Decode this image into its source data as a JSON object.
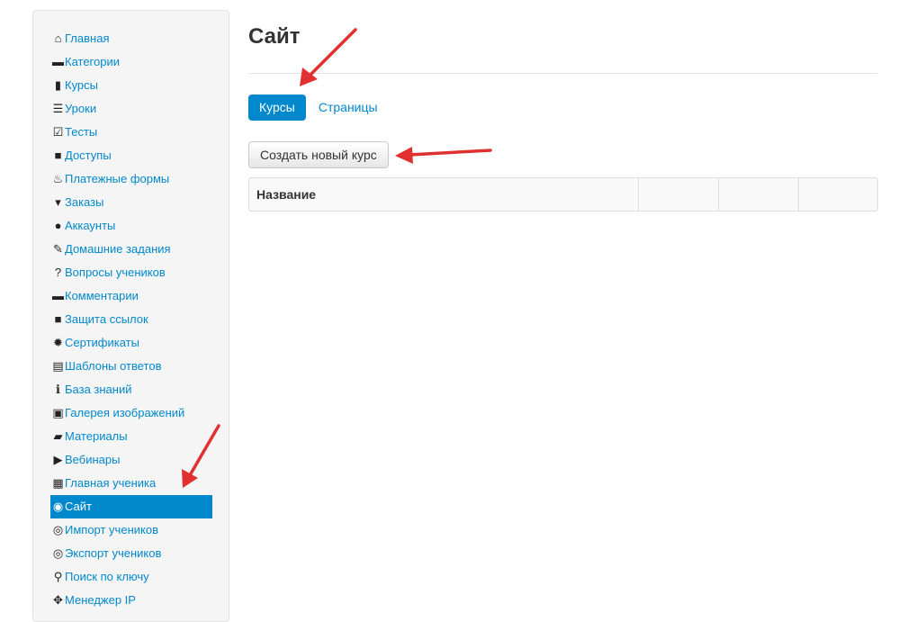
{
  "sidebar": {
    "items": [
      {
        "label": "Главная",
        "icon": "home-icon",
        "glyph": "⌂"
      },
      {
        "label": "Категории",
        "icon": "folder-icon",
        "glyph": "▬"
      },
      {
        "label": "Курсы",
        "icon": "book-icon",
        "glyph": "▮"
      },
      {
        "label": "Уроки",
        "icon": "list-icon",
        "glyph": "☰"
      },
      {
        "label": "Тесты",
        "icon": "edit-icon",
        "glyph": "☑"
      },
      {
        "label": "Доступы",
        "icon": "lock-icon",
        "glyph": "■"
      },
      {
        "label": "Платежные формы",
        "icon": "fire-icon",
        "glyph": "♨"
      },
      {
        "label": "Заказы",
        "icon": "cart-icon",
        "glyph": "▾"
      },
      {
        "label": "Аккаунты",
        "icon": "user-icon",
        "glyph": "●"
      },
      {
        "label": "Домашние задания",
        "icon": "pencil-icon",
        "glyph": "✎"
      },
      {
        "label": "Вопросы учеников",
        "icon": "question-icon",
        "glyph": "?"
      },
      {
        "label": "Комментарии",
        "icon": "comment-icon",
        "glyph": "▬"
      },
      {
        "label": "Защита ссылок",
        "icon": "lock-icon",
        "glyph": "■"
      },
      {
        "label": "Сертификаты",
        "icon": "certificate-icon",
        "glyph": "✹"
      },
      {
        "label": "Шаблоны ответов",
        "icon": "list-alt-icon",
        "glyph": "▤"
      },
      {
        "label": "База знаний",
        "icon": "info-icon",
        "glyph": "ℹ"
      },
      {
        "label": "Галерея изображений",
        "icon": "picture-icon",
        "glyph": "▣"
      },
      {
        "label": "Материалы",
        "icon": "briefcase-icon",
        "glyph": "▰"
      },
      {
        "label": "Вебинары",
        "icon": "play-icon",
        "glyph": "▶"
      },
      {
        "label": "Главная ученика",
        "icon": "th-large-icon",
        "glyph": "▦"
      },
      {
        "label": "Сайт",
        "icon": "globe-icon",
        "glyph": "◉",
        "active": true
      },
      {
        "label": "Импорт учеников",
        "icon": "upload-circle-icon",
        "glyph": "◎"
      },
      {
        "label": "Экспорт учеников",
        "icon": "download-circle-icon",
        "glyph": "◎"
      },
      {
        "label": "Поиск по ключу",
        "icon": "search-icon",
        "glyph": "⚲"
      },
      {
        "label": "Менеджер IP",
        "icon": "move-icon",
        "glyph": "✥"
      }
    ]
  },
  "main": {
    "title": "Сайт",
    "tabs": [
      {
        "label": "Курсы",
        "active": true
      },
      {
        "label": "Страницы",
        "active": false
      }
    ],
    "create_button": "Создать новый курс",
    "table": {
      "columns": [
        "Название",
        "",
        "",
        ""
      ]
    }
  },
  "colors": {
    "accent": "#0088cc",
    "annotation_arrow": "#e03030"
  }
}
